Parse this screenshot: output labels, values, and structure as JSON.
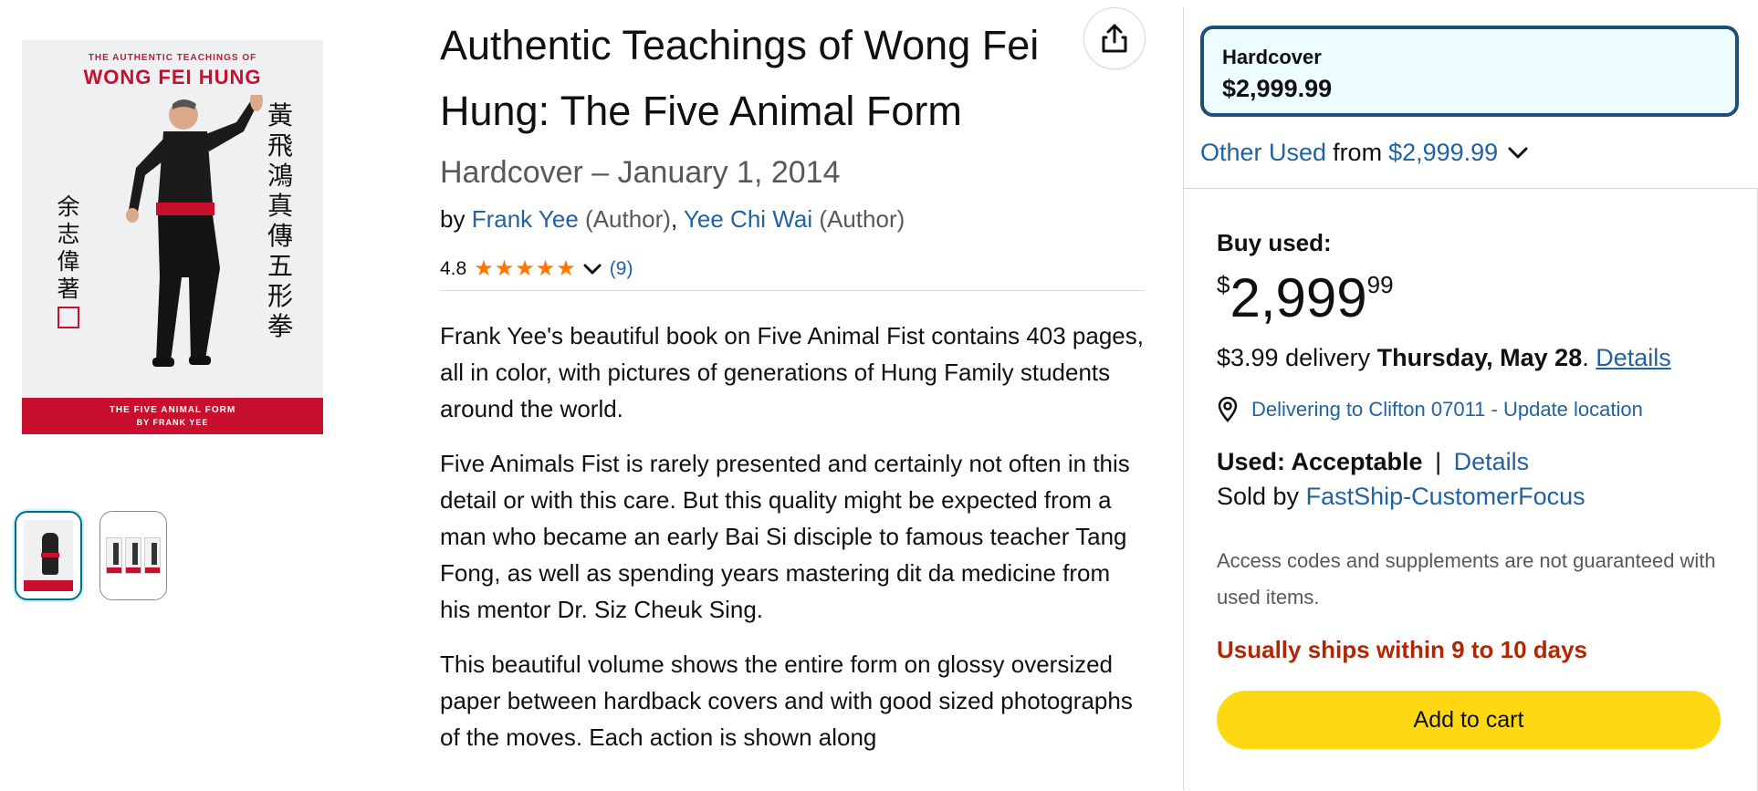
{
  "gallery": {
    "cover_top_line": "THE AUTHENTIC TEACHINGS OF",
    "cover_title": "WONG FEI HUNG",
    "cover_cjk_right": "黃飛鴻真傳五形拳",
    "cover_cjk_left": "余志偉著",
    "cover_band_line1": "THE FIVE ANIMAL FORM",
    "cover_band_line2": "BY FRANK YEE",
    "thumbnails": 2,
    "selected_thumbnail": 1
  },
  "product": {
    "title": "Authentic Teachings of Wong Fei Hung: The Five Animal Form",
    "format_date": "Hardcover – January 1, 2014",
    "by": "by",
    "authors": [
      {
        "name": "Frank Yee",
        "role": "(Author)"
      },
      {
        "name": "Yee Chi Wai",
        "role": "(Author)"
      }
    ],
    "author_separator": ",",
    "rating": "4.8",
    "stars": 5,
    "rating_count": "(9)",
    "share_icon": "share-icon"
  },
  "description": [
    "Frank Yee's beautiful book on Five Animal Fist contains 403 pages, all in color, with pictures of generations of Hung Family students around the world.",
    "Five Animals Fist is rarely presented and certainly not often in this detail or with this care. But this quality might be expected from a man who became an early Bai Si disciple to famous teacher Tang Fong, as well as spending years mastering dit da medicine from his mentor Dr. Siz Cheuk Sing.",
    "This beautiful volume shows the entire form on glossy oversized paper between hardback covers and with good sized photographs of the moves. Each action is shown along"
  ],
  "buybox": {
    "format_label": "Hardcover",
    "format_price": "$2,999.99",
    "other_used_link": "Other Used",
    "other_used_from": "from",
    "other_used_price": "$2,999.99",
    "buy_used_label": "Buy used:",
    "price_symbol": "$",
    "price_whole": "2,999",
    "price_fraction": "99",
    "delivery_fee": "$3.99 delivery",
    "delivery_date": "Thursday, May 28",
    "delivery_period": ".",
    "delivery_details": "Details",
    "location_text": "Delivering to Clifton 07011 - Update location",
    "condition_label": "Used: Acceptable",
    "condition_sep": "|",
    "condition_details": "Details",
    "sold_by_label": "Sold by",
    "seller": "FastShip-CustomerFocus",
    "note": "Access codes and supplements are not guaranteed with used items.",
    "ships_note": "Usually ships within 9 to 10 days",
    "add_to_cart": "Add to cart"
  },
  "colors": {
    "link": "#2162a1",
    "star": "#ff7700",
    "selected_border": "#1f4e79",
    "selected_bg": "#edfdff",
    "ships_red": "#b12704",
    "cart_yellow": "#ffd814",
    "cover_red": "#c8102e"
  }
}
